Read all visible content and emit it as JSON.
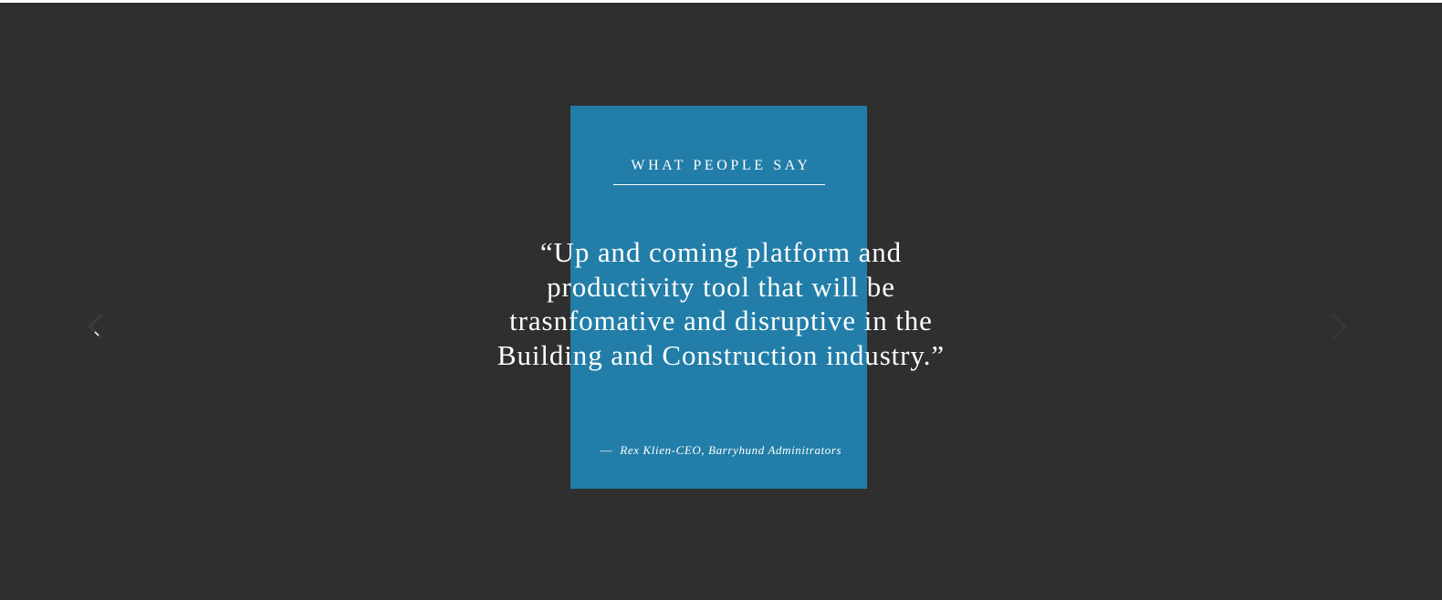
{
  "testimonials": {
    "heading": "What People Say",
    "quote": "“Up and coming platform and productivity tool that will be trasnfomative and disruptive in the Building and Construction industry.”",
    "attribution_dash": "—",
    "attribution": "Rex Klien-CEO, Barryhund Adminitrators"
  },
  "controls": {
    "prev_icon": "chevron-left-icon",
    "next_icon": "chevron-right-icon"
  },
  "colors": {
    "background": "#2f2f2f",
    "panel": "#227ea8",
    "text": "#ffffff"
  }
}
